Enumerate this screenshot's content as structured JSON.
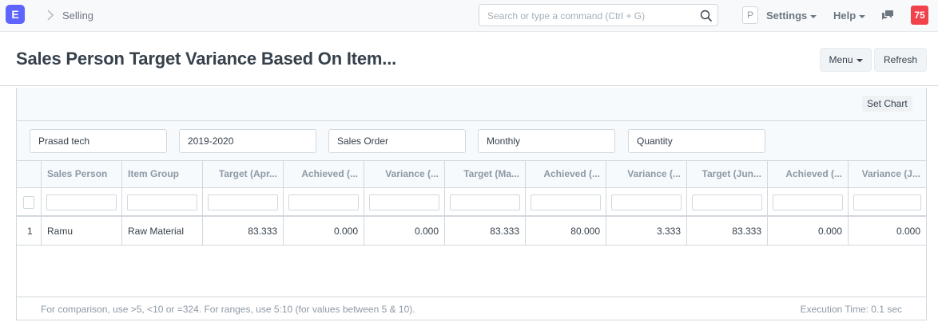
{
  "navbar": {
    "logo": "E",
    "breadcrumb": "Selling",
    "search_placeholder": "Search or type a command (Ctrl + G)",
    "avatar": "P",
    "settings_label": "Settings",
    "help_label": "Help",
    "notification_count": "75"
  },
  "page": {
    "title": "Sales Person Target Variance Based On Item...",
    "menu_label": "Menu",
    "refresh_label": "Refresh"
  },
  "report": {
    "set_chart_label": "Set Chart",
    "filters": [
      "Prasad tech",
      "2019-2020",
      "Sales Order",
      "Monthly",
      "Quantity"
    ],
    "columns": [
      "Sales Person",
      "Item Group",
      "Target (Apr...",
      "Achieved (...",
      "Variance (...",
      "Target (Ma...",
      "Achieved (...",
      "Variance (...",
      "Target (Jun...",
      "Achieved (...",
      "Variance (J..."
    ],
    "rows": [
      {
        "row_number": "1",
        "cells": [
          "Ramu",
          "Raw Material",
          "83.333",
          "0.000",
          "0.000",
          "83.333",
          "80.000",
          "3.333",
          "83.333",
          "0.000",
          "0.000"
        ]
      }
    ],
    "footer_hint": "For comparison, use >5, <10 or =324. For ranges, use 5:10 (for values between 5 & 10).",
    "execution_time": "Execution Time: 0.1 sec"
  }
}
